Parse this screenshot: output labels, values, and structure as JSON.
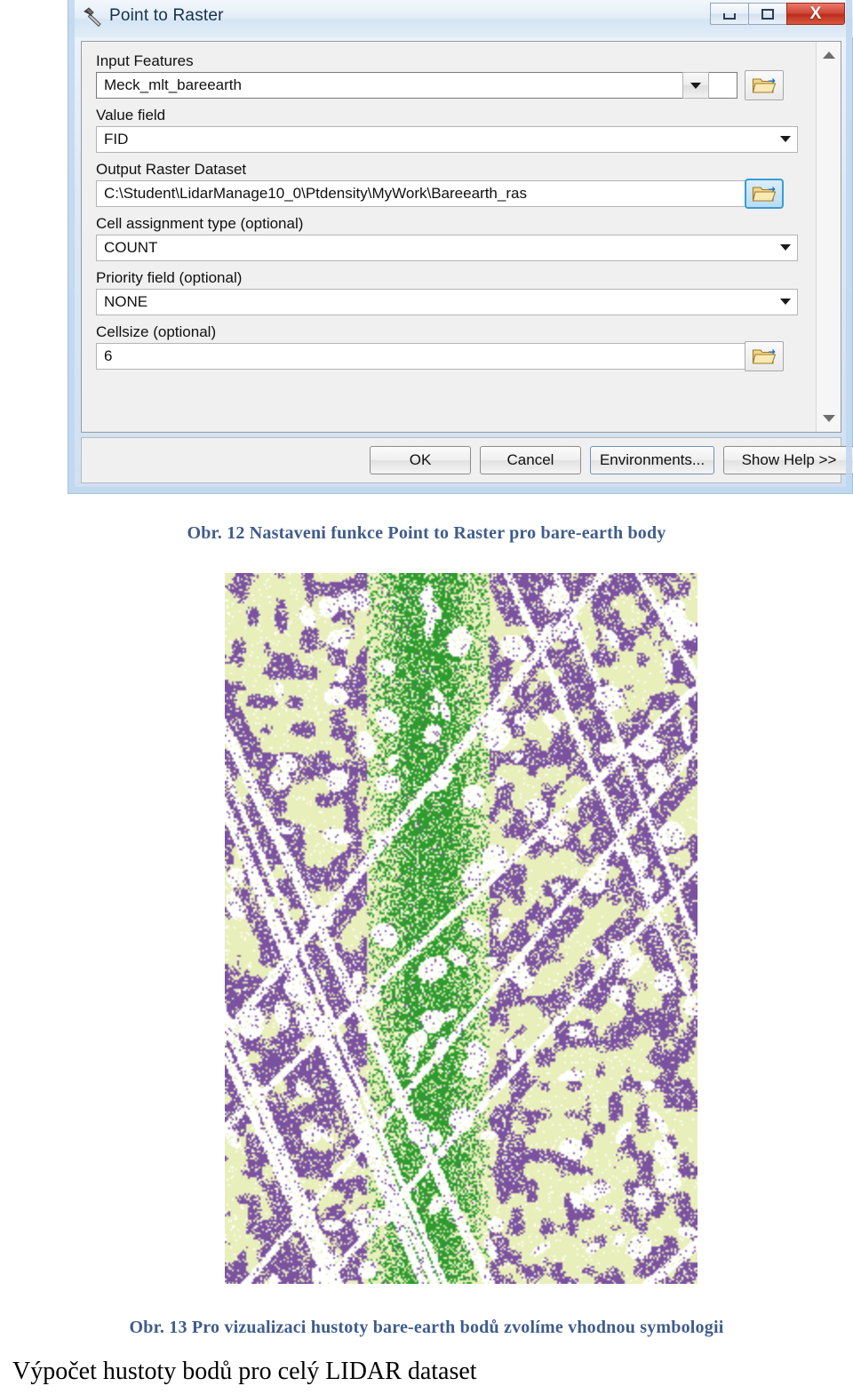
{
  "window": {
    "title": "Point to Raster",
    "icon": "hammer-tool-icon",
    "controls": {
      "minimize": "–",
      "maximize": "□",
      "close": "X"
    }
  },
  "form": {
    "fields": [
      {
        "label": "Input Features",
        "value": "Meck_mlt_bareearth",
        "control": "combo-with-button",
        "browse": true
      },
      {
        "label": "Value field",
        "value": "FID",
        "control": "combo-flat",
        "browse": false
      },
      {
        "label": "Output Raster Dataset",
        "value": "C:\\Student\\LidarManage10_0\\Ptdensity\\MyWork\\Bareearth_ras",
        "control": "text",
        "browse": true
      },
      {
        "label": "Cell assignment type (optional)",
        "value": "COUNT",
        "control": "combo-flat",
        "browse": false
      },
      {
        "label": "Priority field (optional)",
        "value": "NONE",
        "control": "combo-flat",
        "browse": false
      },
      {
        "label": "Cellsize (optional)",
        "value": "6",
        "control": "text",
        "browse": true
      }
    ]
  },
  "buttons": {
    "ok": "OK",
    "cancel": "Cancel",
    "environments": "Environments...",
    "show_help": "Show Help >>"
  },
  "captions": {
    "figure_12": "Obr. 12 Nastaveni funkce Point to Raster pro bare-earth body",
    "figure_13": "Obr. 13 Pro vizualizaci hustoty bare-earth bodů zvolíme vhodnou symbologii"
  },
  "heading": "Výpočet hustoty bodů pro celý LIDAR dataset",
  "map": {
    "description": "point-density raster of bare-earth LIDAR returns",
    "colors": {
      "low": "#e9efbb",
      "mid": "#7b52a0",
      "high": "#2e9b2e",
      "nodata": "#ffffff"
    },
    "swath": {
      "left_fraction": 0.3,
      "right_fraction": 0.56
    }
  }
}
